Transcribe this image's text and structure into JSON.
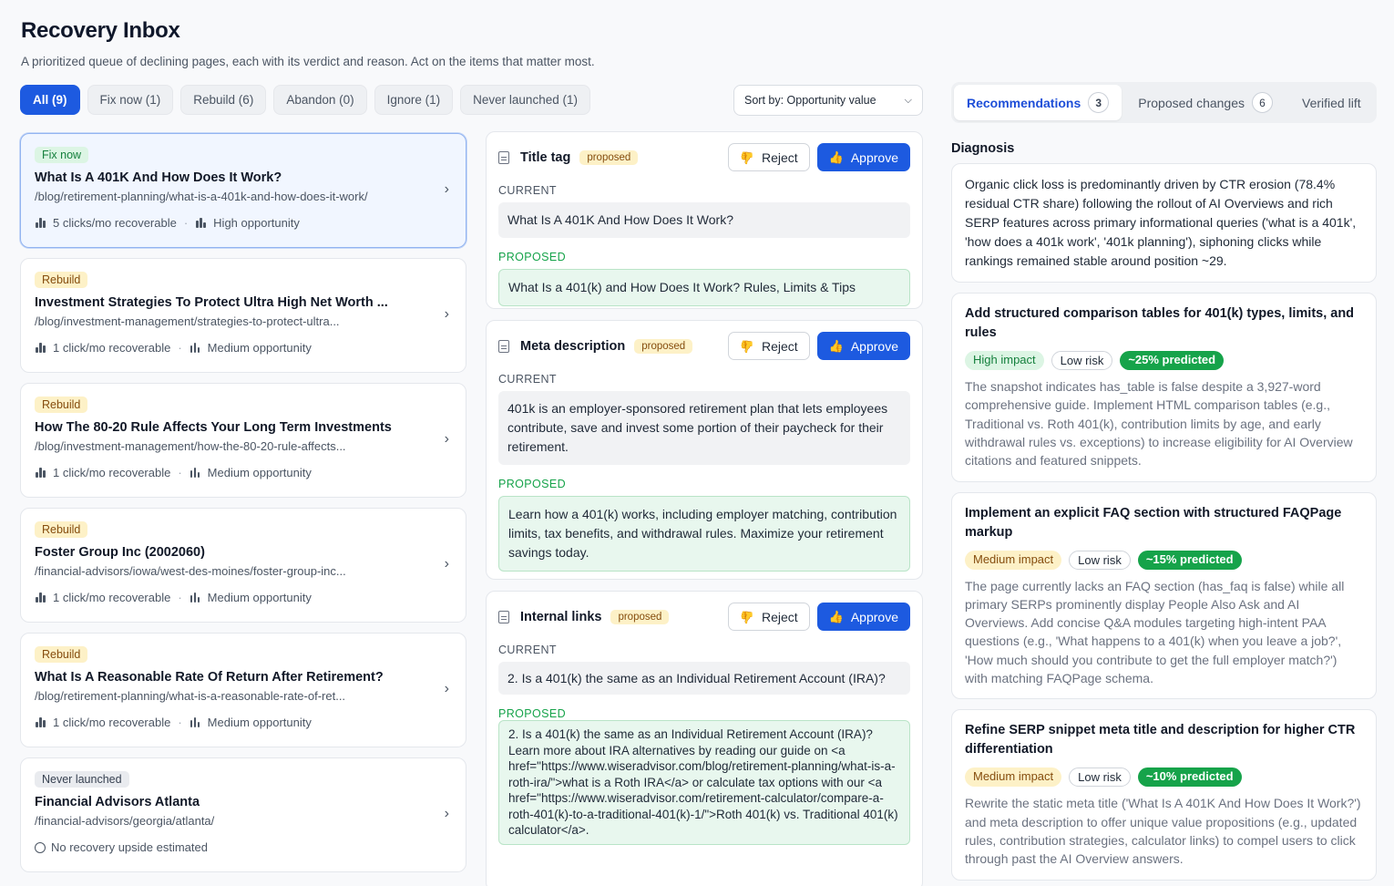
{
  "header": {
    "title": "Recovery Inbox",
    "subtitle": "A prioritized queue of declining pages, each with its verdict and reason. Act on the items that matter most."
  },
  "filters": [
    "All (9)",
    "Fix now (1)",
    "Rebuild (6)",
    "Abandon (0)",
    "Ignore (1)",
    "Never launched (1)"
  ],
  "sort": {
    "label": "Sort by: Opportunity value"
  },
  "items": [
    {
      "verdict": "Fix now",
      "title": "What Is A 401K And How Does It Work?",
      "url": "/blog/retirement-planning/what-is-a-401k-and-how-does-it-work/",
      "clicks": "5 clicks/mo recoverable",
      "opportunity": "High opportunity"
    },
    {
      "verdict": "Rebuild",
      "title": "Investment Strategies To Protect Ultra High Net Worth ...",
      "url": "/blog/investment-management/strategies-to-protect-ultra...",
      "clicks": "1 click/mo recoverable",
      "opportunity": "Medium opportunity"
    },
    {
      "verdict": "Rebuild",
      "title": "How The 80-20 Rule Affects Your Long Term Investments",
      "url": "/blog/investment-management/how-the-80-20-rule-affects...",
      "clicks": "1 click/mo recoverable",
      "opportunity": "Medium opportunity"
    },
    {
      "verdict": "Rebuild",
      "title": "Foster Group Inc (2002060)",
      "url": "/financial-advisors/iowa/west-des-moines/foster-group-inc...",
      "clicks": "1 click/mo recoverable",
      "opportunity": "Medium opportunity"
    },
    {
      "verdict": "Rebuild",
      "title": "What Is A Reasonable Rate Of Return After Retirement?",
      "url": "/blog/retirement-planning/what-is-a-reasonable-rate-of-ret...",
      "clicks": "1 click/mo recoverable",
      "opportunity": "Medium opportunity"
    },
    {
      "verdict": "Never launched",
      "title": "Financial Advisors Atlanta",
      "url": "/financial-advisors/georgia/atlanta/",
      "note": "No recovery upside estimated"
    }
  ],
  "labels": {
    "current": "CURRENT",
    "proposed": "PROPOSED",
    "proposed_tag": "proposed",
    "reject": "Reject",
    "approve": "Approve"
  },
  "changes": [
    {
      "title": "Title tag",
      "current": "What Is A 401K And How Does It Work?",
      "proposed": "What Is a 401(k) and How Does It Work? Rules, Limits & Tips"
    },
    {
      "title": "Meta description",
      "current": "401k is an employer-sponsored retirement plan that lets employees contribute, save and invest some portion of their paycheck for their retirement.",
      "proposed": "Learn how a 401(k) works, including employer matching, contribution limits, tax benefits, and withdrawal rules. Maximize your retirement savings today."
    },
    {
      "title": "Internal links",
      "current": "2. Is a 401(k) the same as an Individual Retirement Account (IRA)?",
      "proposed": "2. Is a 401(k) the same as an Individual Retirement Account (IRA)? Learn more about IRA alternatives by reading our guide on <a href=\"https://www.wiseradvisor.com/blog/retirement-planning/what-is-a-roth-ira/\">what is a Roth IRA</a> or calculate tax options with our <a href=\"https://www.wiseradvisor.com/retirement-calculator/compare-a-roth-401(k)-to-a-traditional-401(k)-1/\">Roth 401(k) vs. Traditional 401(k) calculator</a>."
    }
  ],
  "tabs": [
    {
      "label": "Recommendations",
      "count": "3"
    },
    {
      "label": "Proposed changes",
      "count": "6"
    },
    {
      "label": "Verified lift"
    }
  ],
  "diagnosis": {
    "heading": "Diagnosis",
    "text": "Organic click loss is predominantly driven by CTR erosion (78.4% residual CTR share) following the rollout of AI Overviews and rich SERP features across primary informational queries ('what is a 401k', 'how does a 401k work', '401k planning'), siphoning clicks while rankings remained stable around position ~29."
  },
  "recommendations": [
    {
      "title": "Add structured comparison tables for 401(k) types, limits, and rules",
      "impact": "High impact",
      "risk": "Low risk",
      "predicted": "~25% predicted",
      "body": "The snapshot indicates has_table is false despite a 3,927-word comprehensive guide. Implement HTML comparison tables (e.g., Traditional vs. Roth 401(k), contribution limits by age, and early withdrawal rules vs. exceptions) to increase eligibility for AI Overview citations and featured snippets."
    },
    {
      "title": "Implement an explicit FAQ section with structured FAQPage markup",
      "impact": "Medium impact",
      "risk": "Low risk",
      "predicted": "~15% predicted",
      "body": "The page currently lacks an FAQ section (has_faq is false) while all primary SERPs prominently display People Also Ask and AI Overviews. Add concise Q&A modules targeting high-intent PAA questions (e.g., 'What happens to a 401(k) when you leave a job?', 'How much should you contribute to get the full employer match?') with matching FAQPage schema."
    },
    {
      "title": "Refine SERP snippet meta title and description for higher CTR differentiation",
      "impact": "Medium impact",
      "risk": "Low risk",
      "predicted": "~10% predicted",
      "body": "Rewrite the static meta title ('What Is A 401K And How Does It Work?') and meta description to offer unique value propositions (e.g., updated rules, contribution strategies, calculator links) to compel users to click through past the AI Overview answers."
    }
  ]
}
